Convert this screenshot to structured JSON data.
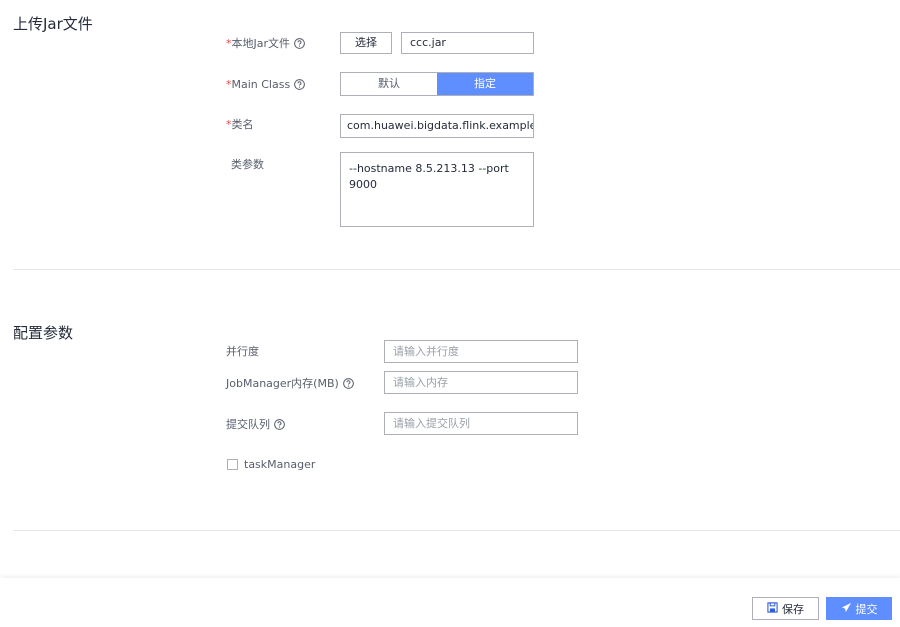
{
  "upload_section": {
    "title": "上传Jar文件",
    "local_jar": {
      "required_mark": "*",
      "label": "本地Jar文件",
      "select_button": "选择",
      "file_name": "ccc.jar"
    },
    "main_class": {
      "required_mark": "*",
      "label": "Main Class",
      "options": [
        "默认",
        "指定"
      ],
      "selected": "指定"
    },
    "class_name": {
      "required_mark": "*",
      "label": "类名",
      "value": "com.huawei.bigdata.flink.examples.Sc"
    },
    "class_params": {
      "label": "类参数",
      "value": "--hostname 8.5.213.13 --port 9000"
    }
  },
  "config_section": {
    "title": "配置参数",
    "parallelism": {
      "label": "并行度",
      "placeholder": "请输入并行度"
    },
    "jobmanager_memory": {
      "label": "JobManager内存(MB)",
      "placeholder": "请输入内存"
    },
    "submit_queue": {
      "label": "提交队列",
      "placeholder": "请输入提交队列"
    },
    "task_manager": {
      "label": "taskManager",
      "checked": false
    }
  },
  "footer": {
    "save_label": "保存",
    "submit_label": "提交"
  },
  "colors": {
    "accent": "#5e8eff",
    "required": "#e54545",
    "border": "#adb0b8"
  }
}
